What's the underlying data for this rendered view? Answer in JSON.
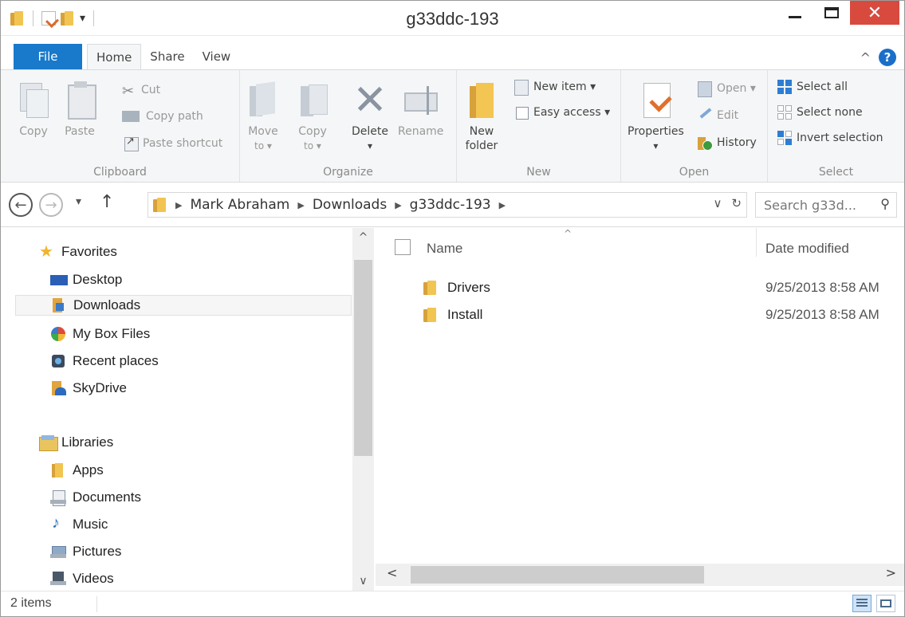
{
  "window": {
    "title": "g33ddc-193",
    "close_glyph": "✕",
    "qat_dropdown": "▾"
  },
  "tabs": {
    "file": "File",
    "home": "Home",
    "share": "Share",
    "view": "View",
    "collapse_glyph": "^",
    "help_glyph": "?"
  },
  "ribbon": {
    "clipboard": {
      "label": "Clipboard",
      "copy": "Copy",
      "paste": "Paste",
      "cut": "Cut",
      "copy_path": "Copy path",
      "paste_shortcut": "Paste shortcut"
    },
    "organize": {
      "label": "Organize",
      "move_to_1": "Move",
      "move_to_2": "to ▾",
      "copy_to_1": "Copy",
      "copy_to_2": "to ▾",
      "delete": "Delete",
      "delete_arrow": "▾",
      "rename": "Rename"
    },
    "new": {
      "label": "New",
      "new_folder_1": "New",
      "new_folder_2": "folder",
      "new_item": "New item ▾",
      "easy_access": "Easy access ▾"
    },
    "open": {
      "label": "Open",
      "properties": "Properties",
      "properties_arrow": "▾",
      "open": "Open ▾",
      "edit": "Edit",
      "history": "History"
    },
    "select": {
      "label": "Select",
      "select_all": "Select all",
      "select_none": "Select none",
      "invert_selection": "Invert selection"
    }
  },
  "address": {
    "back_glyph": "←",
    "forward_glyph": "→",
    "recent_glyph": "▾",
    "up_glyph": "↑",
    "separator_glyph": "▶",
    "crumbs": [
      "Mark Abraham",
      "Downloads",
      "g33ddc-193"
    ],
    "dropdown_glyph": "∨",
    "refresh_glyph": "↻",
    "search_placeholder": "Search g33d...",
    "search_glyph": "⚲"
  },
  "nav_pane": {
    "scroll_up": "^",
    "scroll_down": "∨",
    "favorites": "Favorites",
    "favorites_items": [
      "Desktop",
      "Downloads",
      "My Box Files",
      "Recent places",
      "SkyDrive"
    ],
    "libraries": "Libraries",
    "libraries_items": [
      "Apps",
      "Documents",
      "Music",
      "Pictures",
      "Videos"
    ]
  },
  "file_list": {
    "columns": {
      "name": "Name",
      "date_modified": "Date modified"
    },
    "rows": [
      {
        "name": "Drivers",
        "date_modified": "9/25/2013 8:58 AM"
      },
      {
        "name": "Install",
        "date_modified": "9/25/2013 8:58 AM"
      }
    ],
    "scroll_left": "<",
    "scroll_right": ">"
  },
  "status_bar": {
    "item_count": "2 items"
  }
}
